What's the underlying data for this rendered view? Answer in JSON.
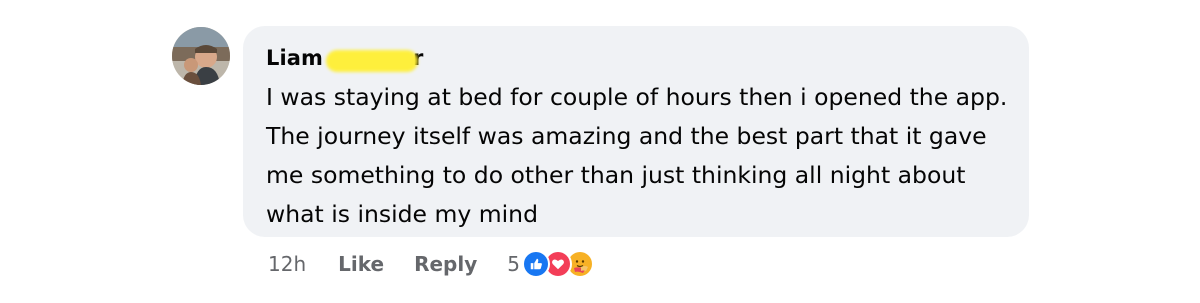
{
  "comment": {
    "author": "Liam",
    "author_suffix": "r",
    "body": "I was staying at bed for couple of hours then i opened the app. The journey itself was amazing and the best part that it gave me something to do other than just thinking all night about what is inside my mind",
    "timestamp": "12h",
    "like_label": "Like",
    "reply_label": "Reply",
    "reaction_count": "5",
    "reactions": [
      "like-icon",
      "love-icon",
      "care-icon"
    ]
  },
  "colors": {
    "bubble": "#f0f2f5",
    "like": "#1877f2",
    "love": "#f33e58",
    "care": "#f7b125",
    "meta_text": "#65676b",
    "redaction": "#ffef33"
  }
}
